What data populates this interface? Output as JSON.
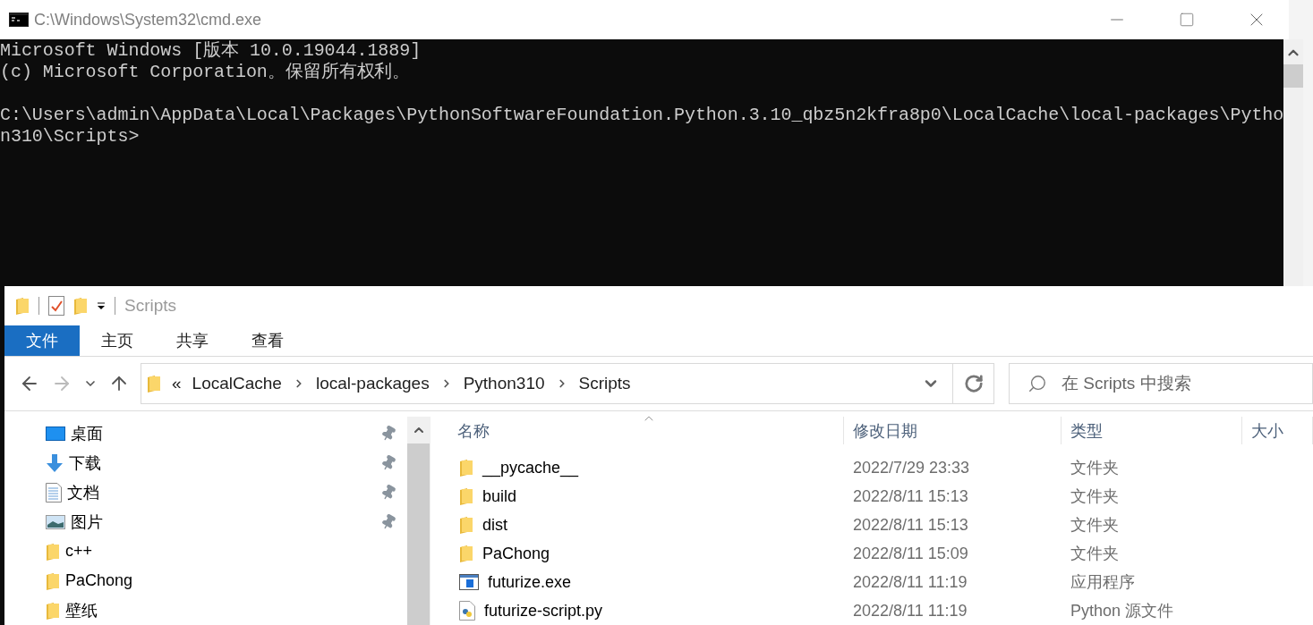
{
  "console_window": {
    "title": "C:\\Windows\\System32\\cmd.exe",
    "blocks": [
      [
        "Microsoft Windows [版本 10.0.19044.1889]",
        "(c) Microsoft Corporation。保留所有权利。"
      ],
      [
        "C:\\Users\\admin\\AppData\\Local\\Packages\\PythonSoftwareFoundation.Python.3.10_qbz5n2kfra8p0\\LocalCache\\local-packages\\Pytho",
        "n310\\Scripts>"
      ]
    ]
  },
  "explorer": {
    "title": "Scripts",
    "ribbon_tabs": [
      {
        "label": "文件",
        "selected": true
      },
      {
        "label": "主页",
        "selected": false
      },
      {
        "label": "共享",
        "selected": false
      },
      {
        "label": "查看",
        "selected": false
      }
    ],
    "address": {
      "overflow": "«",
      "crumbs": [
        "LocalCache",
        "local-packages",
        "Python310",
        "Scripts"
      ]
    },
    "search": {
      "placeholder": "在 Scripts 中搜索"
    },
    "sidebar": {
      "items": [
        {
          "label": "桌面",
          "kind": "desktop",
          "pinned": true
        },
        {
          "label": "下载",
          "kind": "download",
          "pinned": true
        },
        {
          "label": "文档",
          "kind": "document",
          "pinned": true
        },
        {
          "label": "图片",
          "kind": "picture",
          "pinned": true
        },
        {
          "label": "c++",
          "kind": "folder",
          "pinned": false
        },
        {
          "label": "PaChong",
          "kind": "folder",
          "pinned": false
        },
        {
          "label": "壁纸",
          "kind": "folder",
          "pinned": false
        }
      ]
    },
    "table": {
      "columns": [
        "名称",
        "修改日期",
        "类型",
        "大小"
      ],
      "rows": [
        {
          "name": "__pycache__",
          "kind": "folder",
          "date": "2022/7/29 23:33",
          "type": "文件夹"
        },
        {
          "name": "build",
          "kind": "folder",
          "date": "2022/8/11 15:13",
          "type": "文件夹"
        },
        {
          "name": "dist",
          "kind": "folder",
          "date": "2022/8/11 15:13",
          "type": "文件夹"
        },
        {
          "name": "PaChong",
          "kind": "folder",
          "date": "2022/8/11 15:09",
          "type": "文件夹"
        },
        {
          "name": "futurize.exe",
          "kind": "exe",
          "date": "2022/8/11 11:19",
          "type": "应用程序"
        },
        {
          "name": "futurize-script.py",
          "kind": "py",
          "date": "2022/8/11 11:19",
          "type": "Python 源文件"
        }
      ]
    }
  }
}
